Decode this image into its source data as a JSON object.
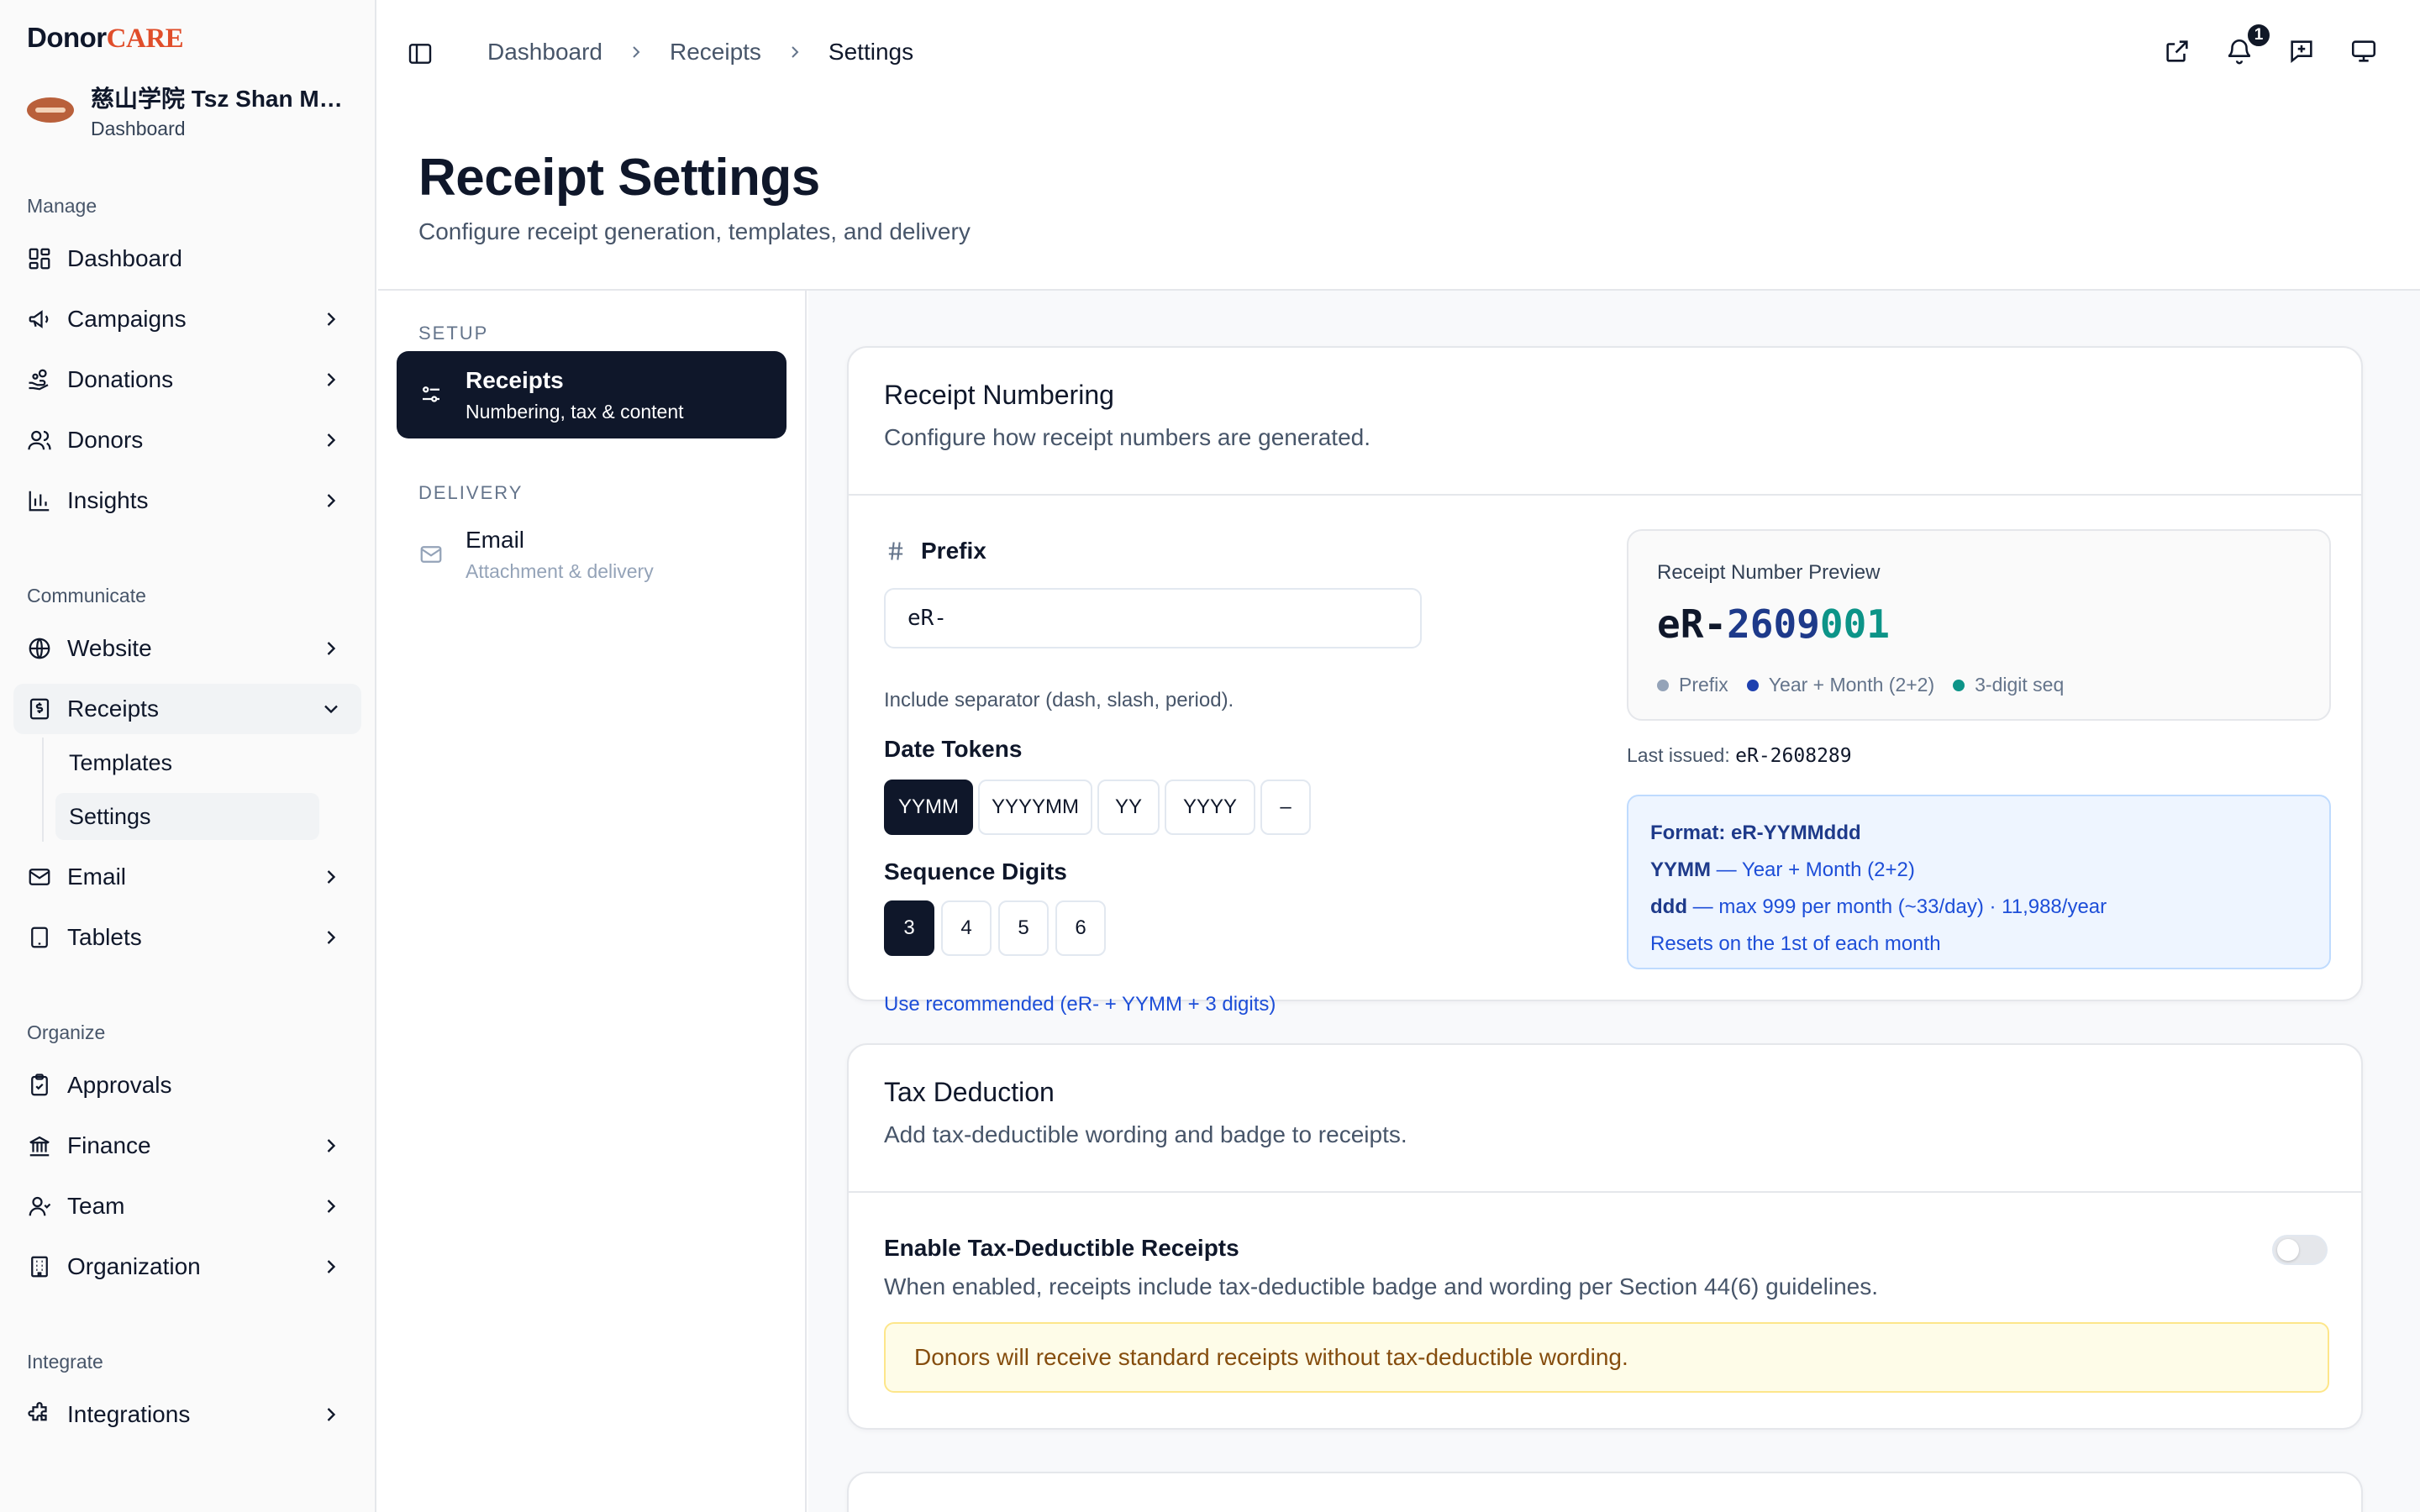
{
  "brand": {
    "part1": "Donor",
    "part2": "CARE"
  },
  "org": {
    "name": "慈山学院 Tsz Shan Mo...",
    "sub": "Dashboard"
  },
  "nav": {
    "groups": {
      "manage": "Manage",
      "communicate": "Communicate",
      "organize": "Organize",
      "integrate": "Integrate"
    },
    "items": {
      "dashboard": "Dashboard",
      "campaigns": "Campaigns",
      "donations": "Donations",
      "donors": "Donors",
      "insights": "Insights",
      "website": "Website",
      "receipts": "Receipts",
      "templates": "Templates",
      "settings": "Settings",
      "email": "Email",
      "tablets": "Tablets",
      "approvals": "Approvals",
      "finance": "Finance",
      "team": "Team",
      "organization": "Organization",
      "integrations": "Integrations"
    }
  },
  "breadcrumb": [
    "Dashboard",
    "Receipts",
    "Settings"
  ],
  "notifications": {
    "count": "1"
  },
  "page": {
    "title": "Receipt Settings",
    "subtitle": "Configure receipt generation, templates, and delivery"
  },
  "settings_nav": {
    "setup_label": "SETUP",
    "delivery_label": "DELIVERY",
    "receipts": {
      "title": "Receipts",
      "sub": "Numbering, tax & content"
    },
    "email": {
      "title": "Email",
      "sub": "Attachment & delivery"
    }
  },
  "numbering": {
    "title": "Receipt Numbering",
    "desc": "Configure how receipt numbers are generated.",
    "prefix_label": "Prefix",
    "prefix_value": "eR-",
    "prefix_hint": "Include separator (dash, slash, period).",
    "date_tokens_label": "Date Tokens",
    "date_tokens": [
      "YYMM",
      "YYYYMM",
      "YY",
      "YYYY",
      "–"
    ],
    "seq_label": "Sequence Digits",
    "seq_digits": [
      "3",
      "4",
      "5",
      "6"
    ],
    "recommended_link": "Use recommended (eR- + YYMM + 3 digits)",
    "preview": {
      "label": "Receipt Number Preview",
      "prefix": "eR-",
      "date": "2609",
      "seq": "001",
      "legend": [
        "Prefix",
        "Year + Month (2+2)",
        "3-digit seq"
      ],
      "legend_colors": [
        "#94a3b8",
        "#1e40af",
        "#0d9488"
      ]
    },
    "last_issued_label": "Last issued:",
    "last_issued_value": "eR-2608289",
    "format": {
      "title": "Format: eR-YYMMddd",
      "line1_key": "YYMM",
      "line1_text": " — Year + Month (2+2)",
      "line2_key": "ddd",
      "line2_text": " — max 999 per month (~33/day) · 11,988/year",
      "line3": "Resets on the 1st of each month"
    }
  },
  "tax": {
    "title": "Tax Deduction",
    "desc": "Add tax-deductible wording and badge to receipts.",
    "toggle_label": "Enable Tax-Deductible Receipts",
    "toggle_desc": "When enabled, receipts include tax-deductible badge and wording per Section 44(6) guidelines.",
    "warning": "Donors will receive standard receipts without tax-deductible wording."
  },
  "colors": {
    "primary": "#0f172a",
    "brand_accent": "#e04e2b",
    "link": "#1d4ed8",
    "seq": "#0d9488"
  }
}
